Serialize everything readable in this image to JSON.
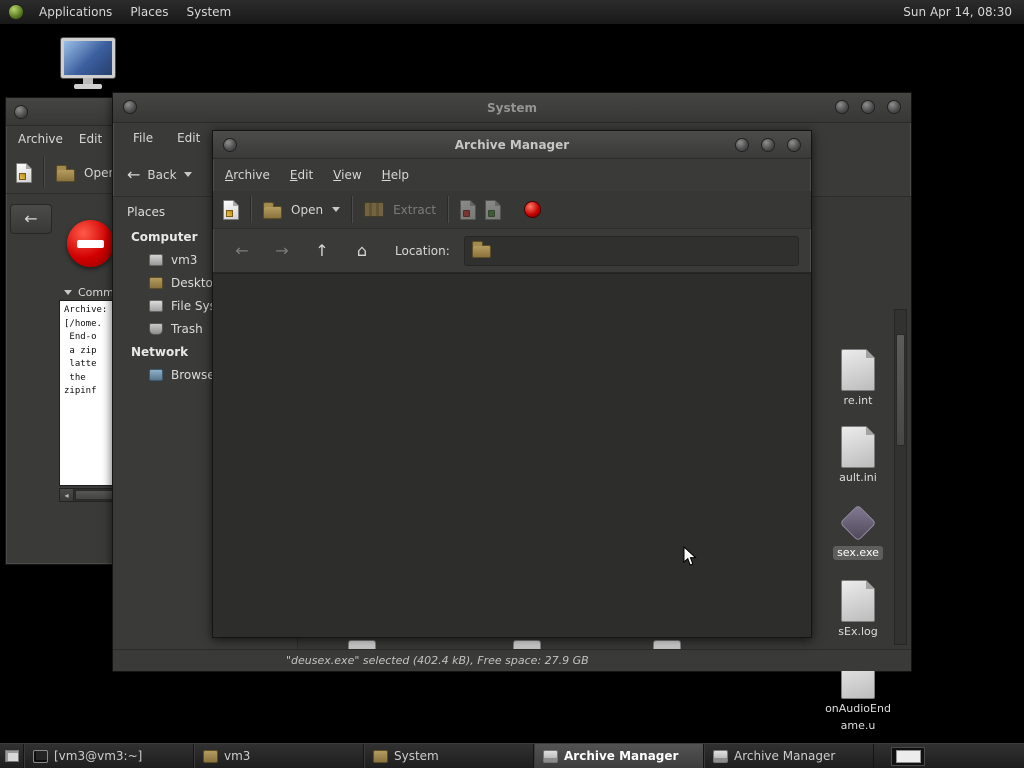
{
  "panel": {
    "menus": [
      {
        "label": "Applications"
      },
      {
        "label": "Places"
      },
      {
        "label": "System"
      }
    ],
    "clock": "Sun Apr 14, 08:30"
  },
  "back_window": {
    "menus": [
      {
        "label": "Archive"
      },
      {
        "label": "Edit"
      }
    ],
    "open_label": "Open",
    "expander_label": "Comm",
    "output_text": "Archive:\n[/home.\n End-o\n a zip\n latte\n the\nzipinf"
  },
  "system_window": {
    "title": "System",
    "menus": [
      {
        "label": "File"
      },
      {
        "label": "Edit"
      }
    ],
    "back_label": "Back",
    "places_label": "Places",
    "sidebar": [
      {
        "label": "Computer"
      },
      {
        "label": "vm3"
      },
      {
        "label": "Desktop"
      },
      {
        "label": "File Syst"
      },
      {
        "label": "Trash"
      },
      {
        "label": "Network"
      },
      {
        "label": "Browse"
      }
    ],
    "files": [
      {
        "label": "re.int"
      },
      {
        "label": "ault.ini"
      },
      {
        "label": "sex.exe"
      },
      {
        "label": "sEx.log"
      },
      {
        "label": "onAudioEnd",
        "label2": "ame.u"
      }
    ],
    "status": "\"deusex.exe\" selected (402.4 kB), Free space: 27.9 GB"
  },
  "archive_window": {
    "title": "Archive Manager",
    "menus": [
      {
        "label": "Archive"
      },
      {
        "label": "Edit"
      },
      {
        "label": "View"
      },
      {
        "label": "Help"
      }
    ],
    "toolbar": {
      "open_label": "Open",
      "extract_label": "Extract"
    },
    "location_label": "Location:"
  },
  "taskbar": {
    "items": [
      {
        "label": "[vm3@vm3:~]"
      },
      {
        "label": "vm3"
      },
      {
        "label": "System"
      },
      {
        "label": "Archive Manager"
      },
      {
        "label": "Archive Manager"
      }
    ]
  }
}
